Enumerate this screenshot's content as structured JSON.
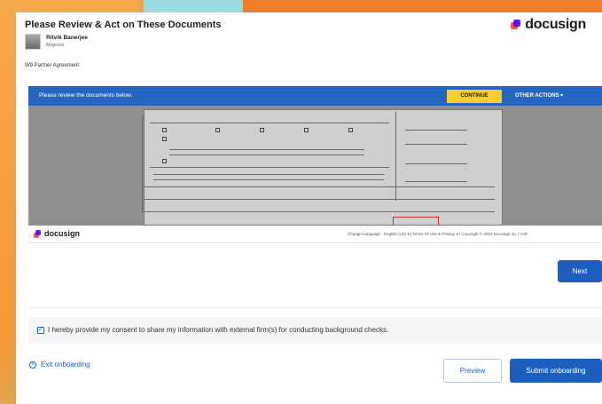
{
  "header": {
    "title": "Please Review & Act on These Documents",
    "brand": "docusign",
    "sender_name": "Ritvik Banerjee",
    "sender_org": "Majesco",
    "envelope_name": "W9 Partner Agreement"
  },
  "review_bar": {
    "message": "Please review the documents below.",
    "continue_label": "CONTINUE",
    "other_actions_label": "OTHER ACTIONS"
  },
  "footer": {
    "brand": "docusign",
    "links": "Change Language - English (US) ▾  |  Terms Of Use & Privacy ▾  |  Copyright © 2024 Docusign Inc | V2R"
  },
  "actions": {
    "next_label": "Next",
    "consent_text": "I hereby provide my consent to share my information with external firm(s) for conducting background checks.",
    "consent_checked": true,
    "exit_label": "Exit onboarding",
    "preview_label": "Preview",
    "submit_label": "Submit onboarding"
  },
  "colors": {
    "primary": "#1d5fbf",
    "review_bar": "#2567c0",
    "continue": "#fccd2d",
    "orange_frame": "#ef7e2a",
    "teal_frame": "#8ad2d8"
  }
}
